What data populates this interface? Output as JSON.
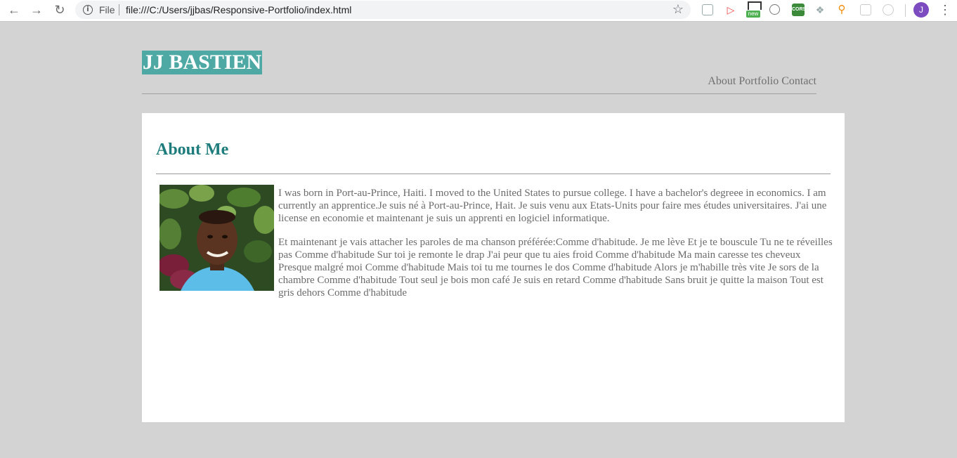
{
  "browser": {
    "scheme": "File",
    "url": "file:///C:/Users/jjbas/Responsive-Portfolio/index.html",
    "profile_initial": "J",
    "extensions": [
      "extension-icon",
      "extension-icon",
      "screenshot-extension-icon",
      "extension-icon",
      "cors-extension-icon",
      "extension-icon",
      "key-extension-icon",
      "extension-icon",
      "extension-icon"
    ],
    "extension_badge": "new",
    "cors_label": "CORS"
  },
  "site": {
    "logo": "JJ BASTIEN",
    "nav": [
      "About",
      "Portfolio",
      "Contact"
    ]
  },
  "about": {
    "heading": "About Me",
    "paragraphs": [
      "I was born in Port-au-Prince, Haiti. I moved to the United States to pursue college. I have a bachelor's degreee in economics. I am currently an apprentice.Je suis né à Port-au-Prince, Hait. Je suis venu aux Etats-Units pour faire mes études universitaires. J'ai une license en economie et maintenant je suis un apprenti en logiciel informatique.",
      "Et maintenant je vais attacher les paroles de ma chanson préférée:Comme d'habitude. Je me lève Et je te bouscule Tu ne te réveilles pas Comme d'habitude Sur toi je remonte le drap J'ai peur que tu aies froid Comme d'habitude Ma main caresse tes cheveux Presque malgré moi Comme d'habitude Mais toi tu me tournes le dos Comme d'habitude Alors je m'habille très vite Je sors de la chambre Comme d'habitude Tout seul je bois mon café Je suis en retard Comme d'habitude Sans bruit je quitte la maison Tout est gris dehors Comme d'habitude"
    ]
  }
}
